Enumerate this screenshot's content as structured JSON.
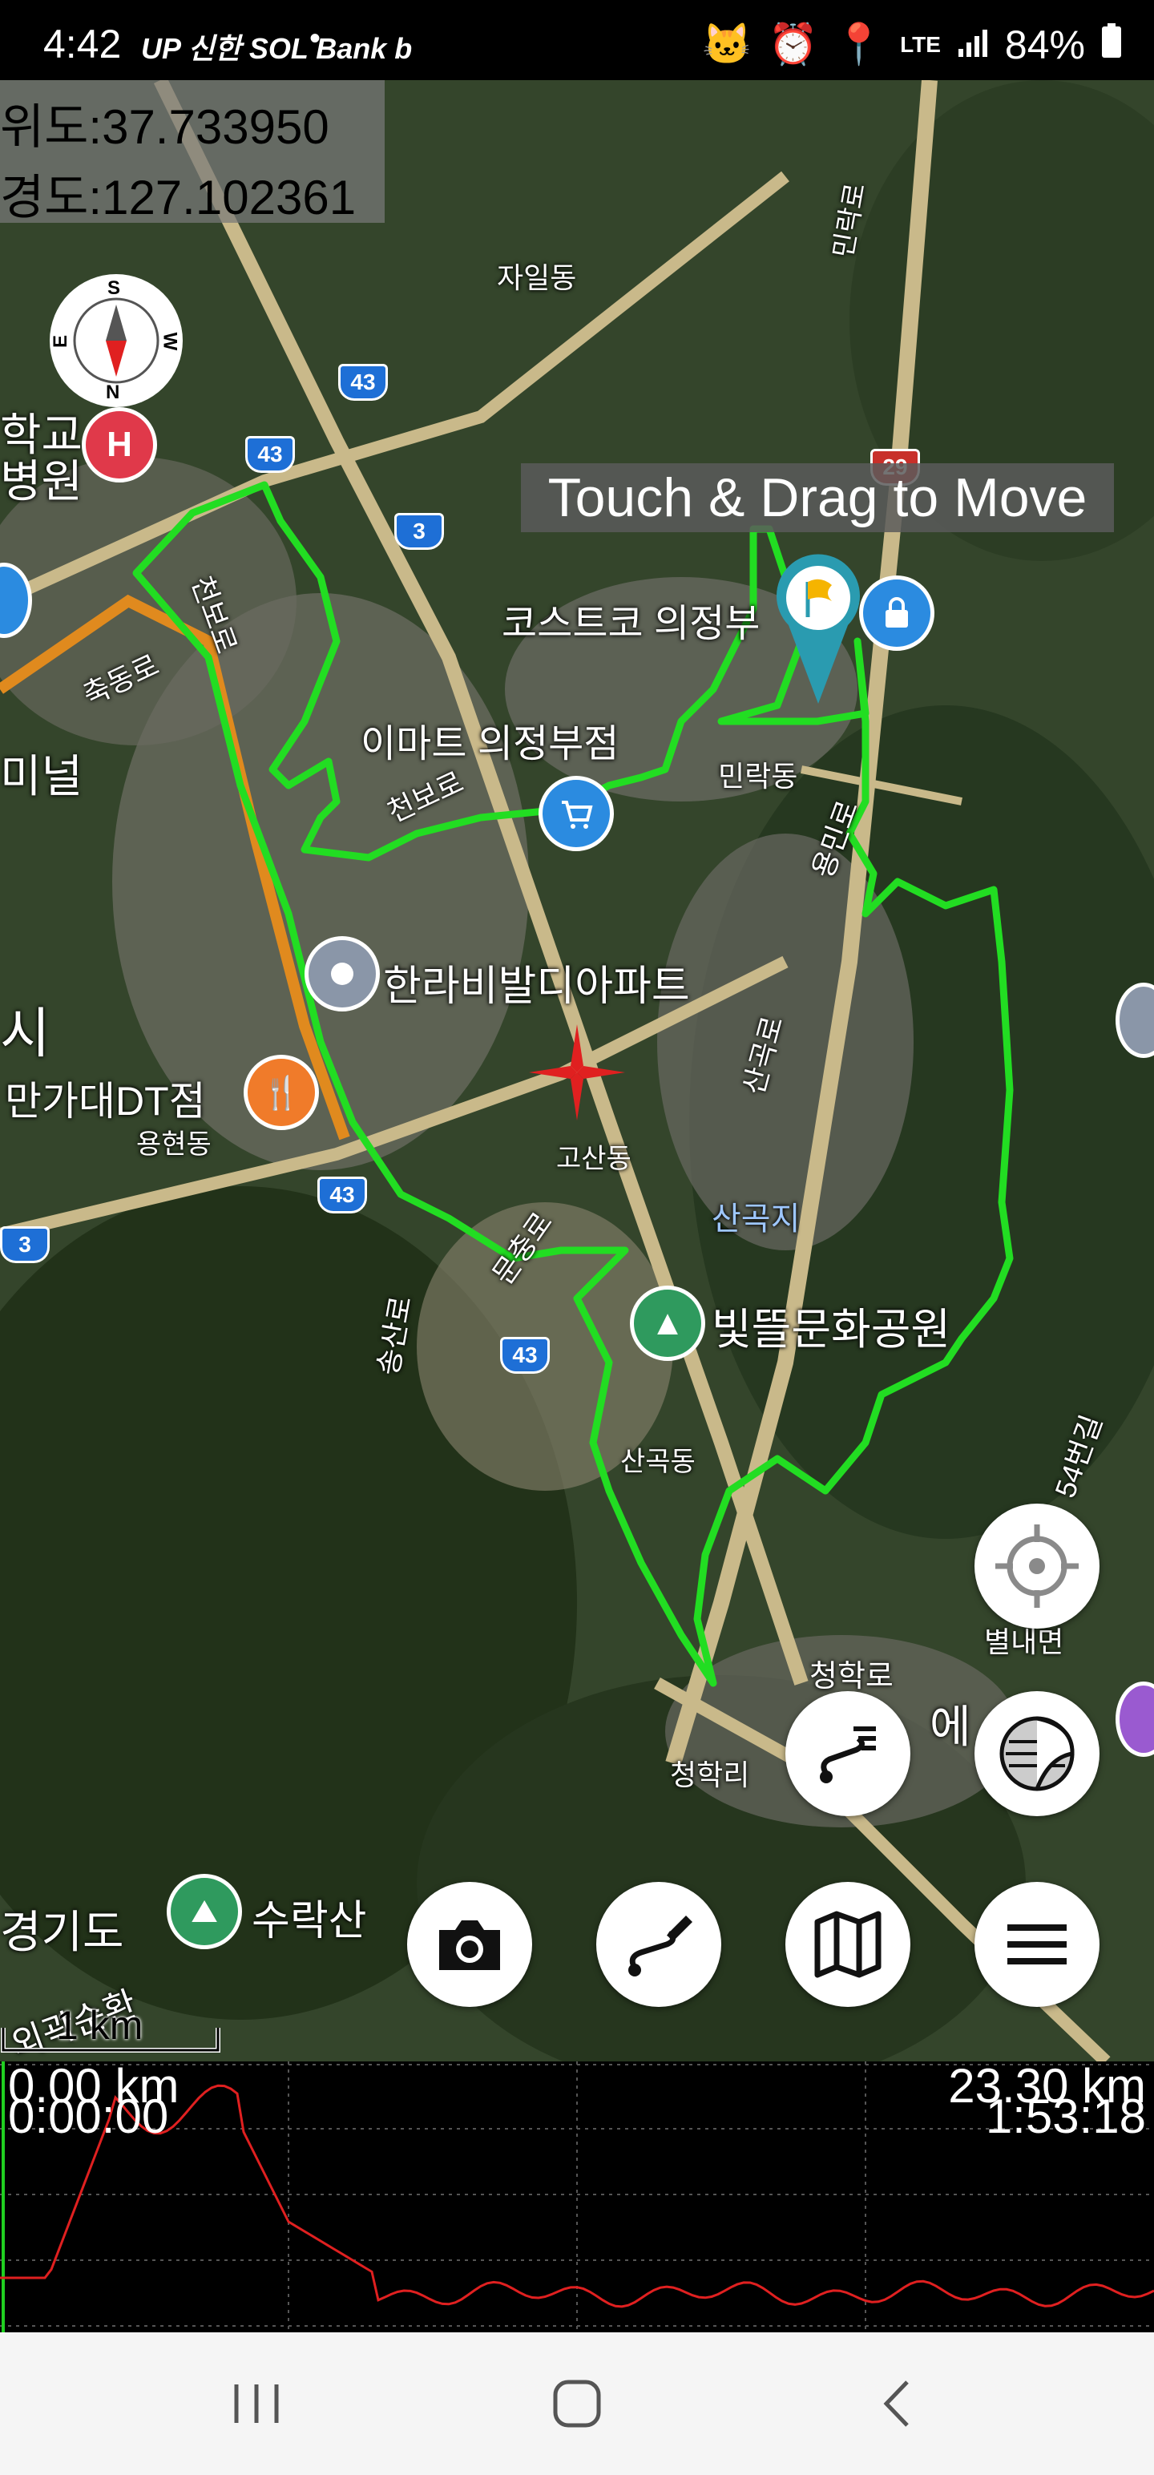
{
  "status_bar": {
    "time": "4:42",
    "carrier_icons": "UP 신한 SOL Bank b",
    "notification_dot": "•",
    "battery_percent": "84%"
  },
  "coordinates": {
    "latitude": "위도:37.733950",
    "longitude": "경도:127.102361"
  },
  "compass": {
    "n": "N",
    "s": "S",
    "e": "E",
    "w": "W"
  },
  "banner": "Touch & Drag to Move",
  "map_labels": {
    "jail": "자일동",
    "minrak": "민락로",
    "school": "학교",
    "hospital": "병원",
    "costco": "코스트코 의정부",
    "emart": "이마트 의정부점",
    "chukdong": "축동로",
    "terminal": "미널",
    "cheonbo": "천보로",
    "cheonbo2": "천보로",
    "minrakdong": "민락동",
    "yongminro": "용민로",
    "hanra": "한라비발디아파트",
    "si": "시",
    "dt": "만가대DT점",
    "yonghyeon": "용현동",
    "gosan": "고산동",
    "sangok_ro": "산곡로",
    "sangokji": "산곡지",
    "munchungro": "문충로",
    "songsan": "송산로",
    "bitteul": "빛뜰문화공원",
    "sangokdong": "산곡동",
    "road54": "54번길",
    "byeolnae": "별내면",
    "cheonghak_ro": "청학로",
    "cheonghak_ri": "청학리",
    "ek": "에",
    "gyeonggi": "경기도",
    "suraksan": "수락산",
    "bypass": "외곽순환",
    "road_43a": "43",
    "road_43b": "43",
    "road_43c": "43",
    "road_43d": "43",
    "road_3a": "3",
    "road_3b": "3",
    "road_29": "29"
  },
  "scale_bar": "1 km",
  "elevation_profile": {
    "start_distance": "0.00 km",
    "start_time": "0:00:00",
    "end_distance": "23.30 km",
    "end_time": "1:53:18"
  },
  "colors": {
    "track": "#22dd22",
    "elevation_line": "#e02020",
    "fab_background": "#ffffff",
    "flag_marker": "#2a9bb0"
  },
  "icons": {
    "camera": "camera-icon",
    "route_edit": "route-edit-icon",
    "map": "map-icon",
    "menu": "menu-icon",
    "route_list": "route-list-icon",
    "layers": "layers-icon",
    "locate": "locate-icon"
  }
}
